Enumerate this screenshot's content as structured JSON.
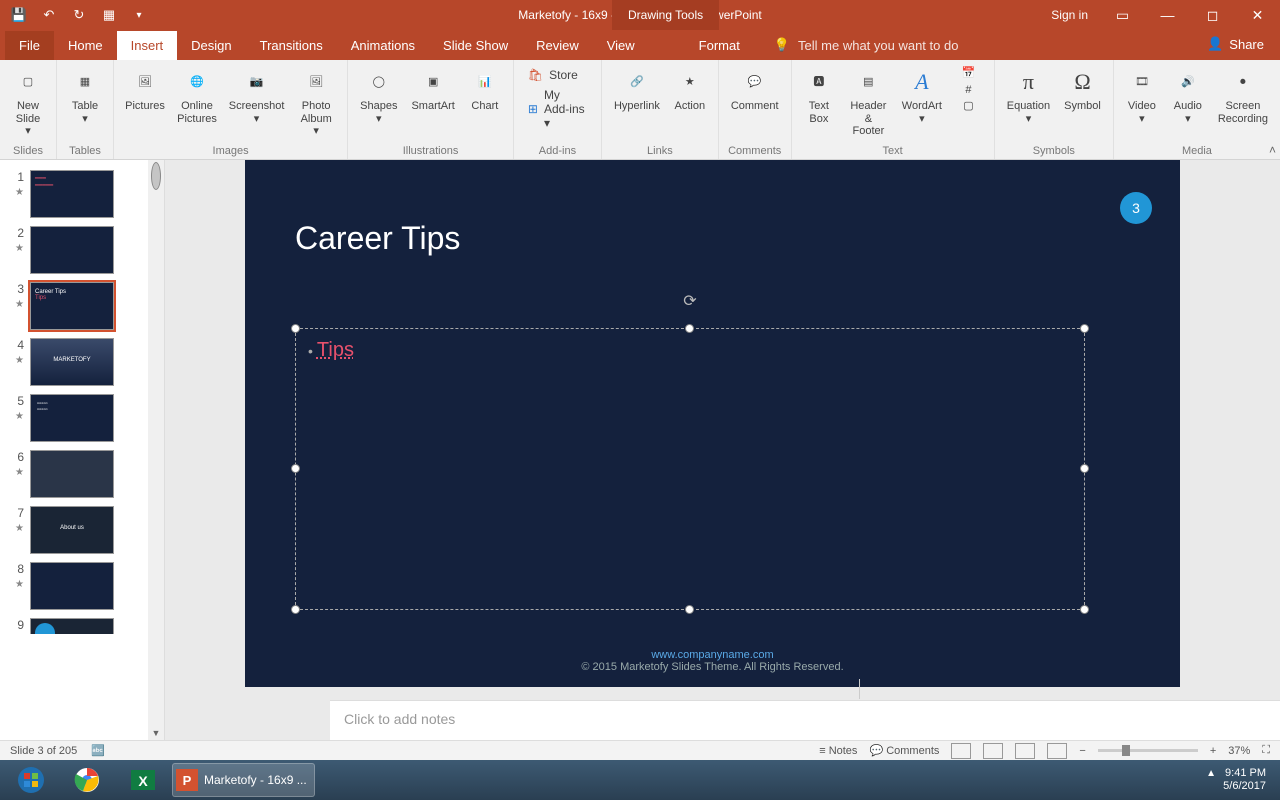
{
  "titlebar": {
    "title": "Marketofy - 16x9 - Colored Light  -  PowerPoint",
    "context_tab": "Drawing Tools",
    "signin": "Sign in"
  },
  "tabs": {
    "file": "File",
    "home": "Home",
    "insert": "Insert",
    "design": "Design",
    "transitions": "Transitions",
    "animations": "Animations",
    "slideshow": "Slide Show",
    "review": "Review",
    "view": "View",
    "format": "Format",
    "tellme": "Tell me what you want to do",
    "share": "Share"
  },
  "ribbon": {
    "slides": {
      "new_slide": "New\nSlide ▾",
      "group": "Slides"
    },
    "tables": {
      "table": "Table\n▾",
      "group": "Tables"
    },
    "images": {
      "pictures": "Pictures",
      "online": "Online\nPictures",
      "screenshot": "Screenshot\n▾",
      "album": "Photo\nAlbum ▾",
      "group": "Images"
    },
    "illus": {
      "shapes": "Shapes\n▾",
      "smartart": "SmartArt",
      "chart": "Chart",
      "group": "Illustrations"
    },
    "addins": {
      "store": "Store",
      "myaddins": "My Add-ins  ▾",
      "group": "Add-ins"
    },
    "links": {
      "hyperlink": "Hyperlink",
      "action": "Action",
      "group": "Links"
    },
    "comments": {
      "comment": "Comment",
      "group": "Comments"
    },
    "text": {
      "textbox": "Text\nBox",
      "header": "Header\n& Footer",
      "wordart": "WordArt\n▾",
      "group": "Text"
    },
    "symbols": {
      "equation": "Equation\n▾",
      "symbol": "Symbol",
      "group": "Symbols"
    },
    "media": {
      "video": "Video\n▾",
      "audio": "Audio\n▾",
      "screen": "Screen\nRecording",
      "group": "Media"
    }
  },
  "slide": {
    "title": "Career Tips",
    "badge": "3",
    "bullet_text": "Tips",
    "footer_url": "www.companyname.com",
    "footer_text": "© 2015 Marketofy Slides Theme. All Rights Reserved."
  },
  "thumbs": {
    "numbers": [
      "1",
      "2",
      "3",
      "4",
      "5",
      "6",
      "7",
      "8",
      "9"
    ],
    "selected_index": 2,
    "about_us": "About us"
  },
  "notes": {
    "placeholder": "Click to add notes"
  },
  "status": {
    "left": "Slide 3 of 205",
    "notes": "Notes",
    "comments": "Comments",
    "zoom": "37%"
  },
  "taskbar": {
    "pp_label": "Marketofy - 16x9 ...",
    "time": "9:41 PM",
    "date": "5/6/2017"
  }
}
